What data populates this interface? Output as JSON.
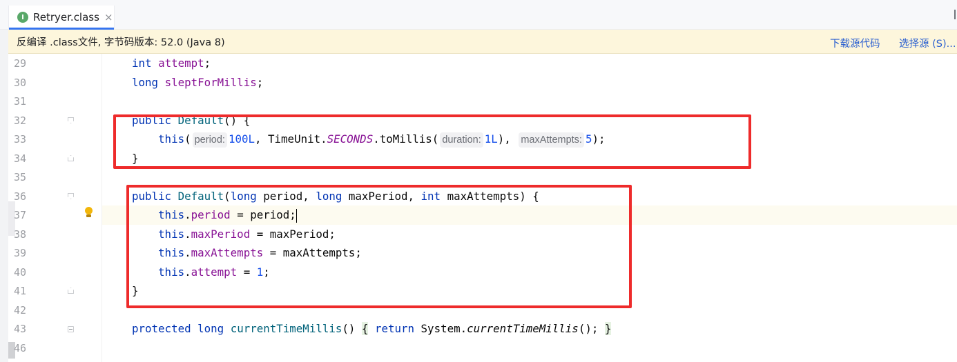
{
  "tab": {
    "icon_letter": "I",
    "label": "Retryer.class",
    "close": "×"
  },
  "banner": {
    "text": "反编译 .class文件, 字节码版本: 52.0 (Java 8)",
    "download_link": "下载源代码",
    "choose_source_link": "选择源 (S)..."
  },
  "editor": {
    "line_numbers": [
      "29",
      "30",
      "31",
      "32",
      "33",
      "34",
      "35",
      "36",
      "37",
      "38",
      "39",
      "40",
      "41",
      "42",
      "43",
      "46"
    ],
    "hints": {
      "period": "period:",
      "duration": "duration:",
      "max_attempts": "maxAttempts:"
    },
    "icons": {
      "bulb": "lightbulb-icon"
    }
  },
  "colors": {
    "keyword": "#0033b3",
    "field": "#871094",
    "number": "#1750eb",
    "highlight_box": "#ee2b2b",
    "banner_bg": "#fdf6dc",
    "accent": "#3574f0"
  }
}
